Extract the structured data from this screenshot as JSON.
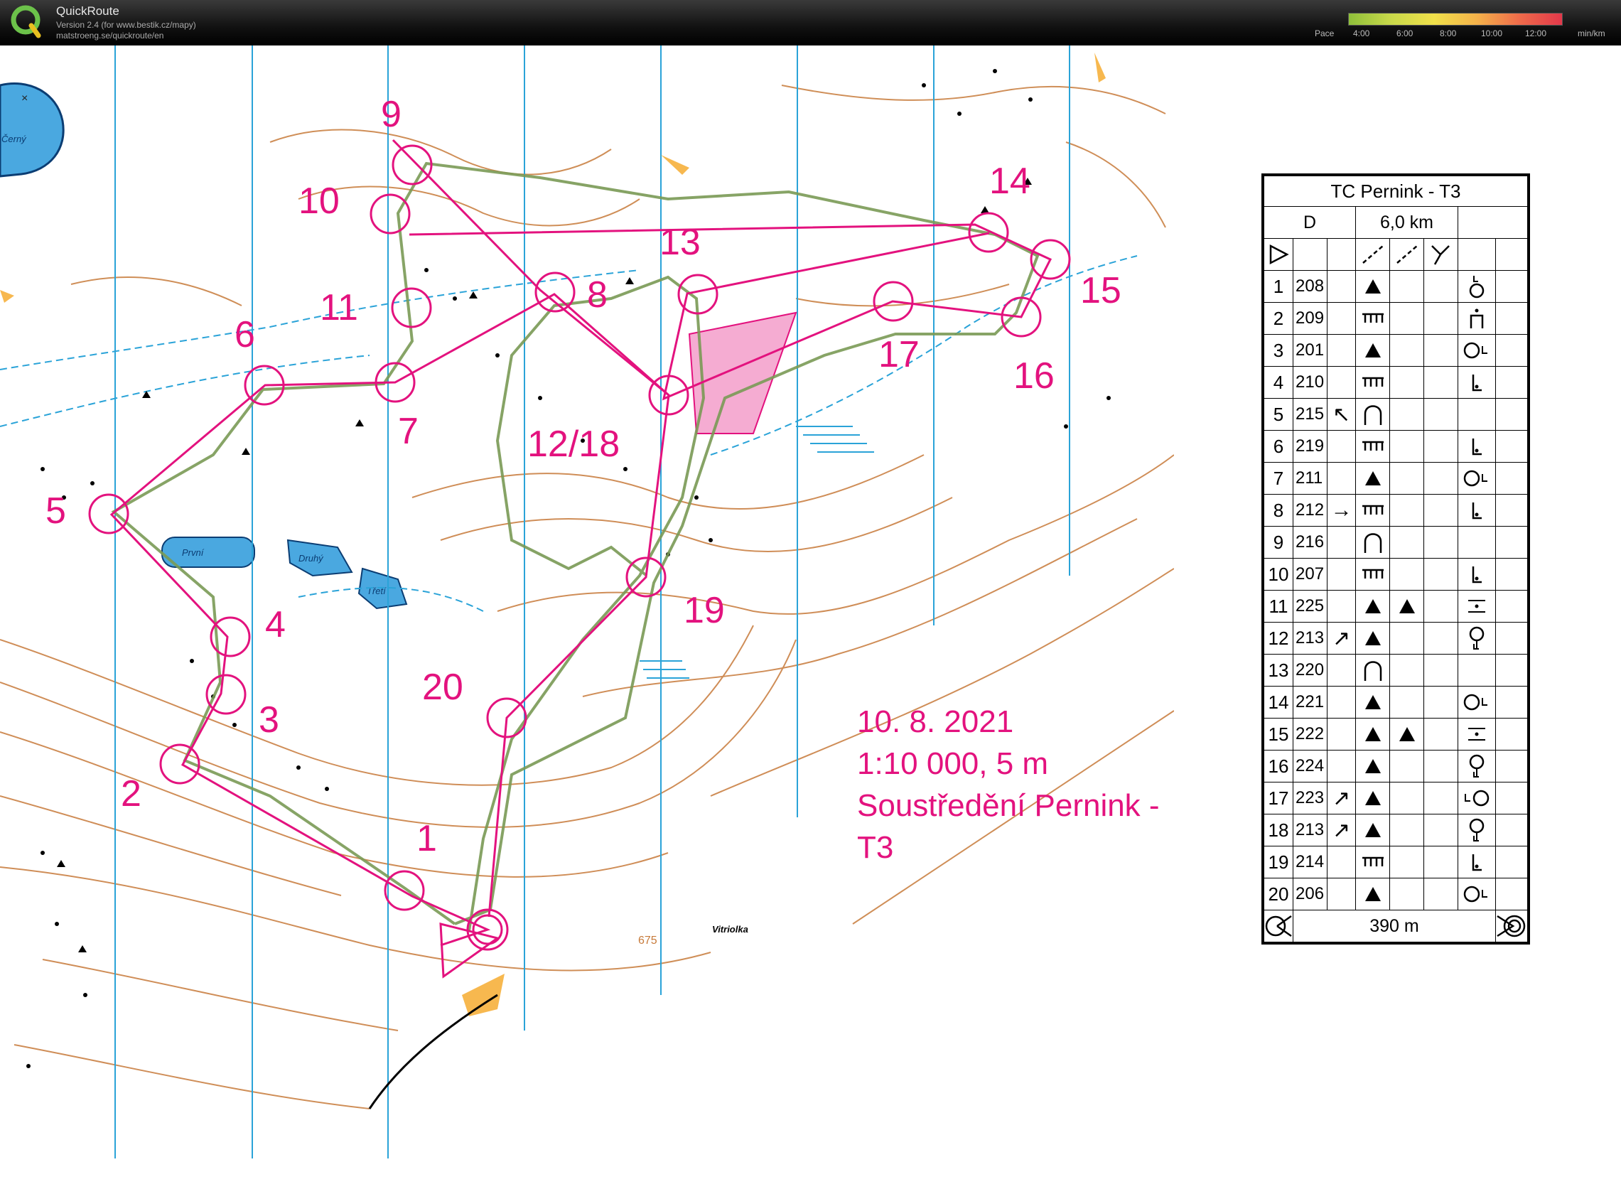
{
  "app": {
    "title": "QuickRoute",
    "version": "Version 2.4  (for www.bestik.cz/mapy)",
    "url": "matstroeng.se/quickroute/en",
    "pace_label": "Pace",
    "pace_ticks": [
      "4:00",
      "6:00",
      "8:00",
      "10:00",
      "12:00"
    ],
    "pace_unit": "min/km",
    "close_glyph": "×"
  },
  "map": {
    "colors": {
      "course": "#e3127e",
      "route": "#7a9a55",
      "contour": "#c77a3a",
      "water": "#2aa3d8",
      "lake": "#4aa8e0",
      "background": "#ffffff"
    },
    "place_names": [
      "Černý",
      "První",
      "Druhý",
      "Třetí",
      "Vitriolka"
    ],
    "spot_height": "675",
    "controls": [
      {
        "label": "1"
      },
      {
        "label": "2"
      },
      {
        "label": "3"
      },
      {
        "label": "4"
      },
      {
        "label": "5"
      },
      {
        "label": "6"
      },
      {
        "label": "7"
      },
      {
        "label": "8"
      },
      {
        "label": "9"
      },
      {
        "label": "10"
      },
      {
        "label": "11"
      },
      {
        "label": "12/18"
      },
      {
        "label": "13"
      },
      {
        "label": "14"
      },
      {
        "label": "15"
      },
      {
        "label": "16"
      },
      {
        "label": "17"
      },
      {
        "label": "19"
      },
      {
        "label": "20"
      }
    ],
    "info_lines": [
      "10. 8. 2021",
      "1:10 000, 5 m",
      "Soustředění Pernink - T3"
    ]
  },
  "description": {
    "title": "TC Pernink - T3",
    "category": "D",
    "length": "6,0 km",
    "finish_distance": "390 m",
    "rows": [
      {
        "num": "1",
        "code": "208",
        "dir": "",
        "feat": "knoll",
        "feat2": "",
        "pos": "ring-top"
      },
      {
        "num": "2",
        "code": "209",
        "dir": "",
        "feat": "rocky",
        "feat2": "",
        "pos": "foot"
      },
      {
        "num": "3",
        "code": "201",
        "dir": "",
        "feat": "knoll",
        "feat2": "",
        "pos": "ring-l"
      },
      {
        "num": "4",
        "code": "210",
        "dir": "",
        "feat": "rocky",
        "feat2": "",
        "pos": "corner"
      },
      {
        "num": "5",
        "code": "215",
        "dir": "↖",
        "feat": "spur",
        "feat2": "",
        "pos": ""
      },
      {
        "num": "6",
        "code": "219",
        "dir": "",
        "feat": "rocky",
        "feat2": "",
        "pos": "corner"
      },
      {
        "num": "7",
        "code": "211",
        "dir": "",
        "feat": "knoll",
        "feat2": "",
        "pos": "ring-l"
      },
      {
        "num": "8",
        "code": "212",
        "dir": "→",
        "feat": "rocky",
        "feat2": "",
        "pos": "corner"
      },
      {
        "num": "9",
        "code": "216",
        "dir": "",
        "feat": "spur",
        "feat2": "",
        "pos": ""
      },
      {
        "num": "10",
        "code": "207",
        "dir": "",
        "feat": "rocky",
        "feat2": "",
        "pos": "corner"
      },
      {
        "num": "11",
        "code": "225",
        "dir": "",
        "feat": "knoll",
        "feat2": "knoll",
        "pos": "between"
      },
      {
        "num": "12",
        "code": "213",
        "dir": "↗",
        "feat": "knoll",
        "feat2": "",
        "pos": "ring-bottom"
      },
      {
        "num": "13",
        "code": "220",
        "dir": "",
        "feat": "spur",
        "feat2": "",
        "pos": ""
      },
      {
        "num": "14",
        "code": "221",
        "dir": "",
        "feat": "knoll",
        "feat2": "",
        "pos": "ring-l"
      },
      {
        "num": "15",
        "code": "222",
        "dir": "",
        "feat": "knoll",
        "feat2": "knoll",
        "pos": "between"
      },
      {
        "num": "16",
        "code": "224",
        "dir": "",
        "feat": "knoll",
        "feat2": "",
        "pos": "ring-bottom"
      },
      {
        "num": "17",
        "code": "223",
        "dir": "↗",
        "feat": "knoll",
        "feat2": "",
        "pos": "l-ring"
      },
      {
        "num": "18",
        "code": "213",
        "dir": "↗",
        "feat": "knoll",
        "feat2": "",
        "pos": "ring-bottom"
      },
      {
        "num": "19",
        "code": "214",
        "dir": "",
        "feat": "rocky",
        "feat2": "",
        "pos": "corner"
      },
      {
        "num": "20",
        "code": "206",
        "dir": "",
        "feat": "knoll",
        "feat2": "",
        "pos": "ring-l"
      }
    ]
  }
}
